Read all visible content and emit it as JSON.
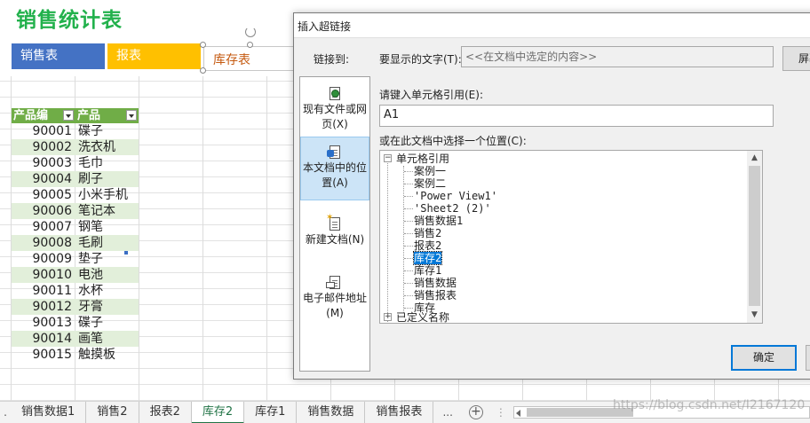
{
  "sheet": {
    "title": "销售统计表",
    "nav_buttons": {
      "sales": "销售表",
      "report": "报表",
      "stock": "库存表"
    },
    "table": {
      "headers": [
        "产品编",
        "产品"
      ],
      "rows": [
        [
          "90001",
          "碟子"
        ],
        [
          "90002",
          "洗衣机"
        ],
        [
          "90003",
          "毛巾"
        ],
        [
          "90004",
          "刷子"
        ],
        [
          "90005",
          "小米手机"
        ],
        [
          "90006",
          "笔记本"
        ],
        [
          "90007",
          "钢笔"
        ],
        [
          "90008",
          "毛刷"
        ],
        [
          "90009",
          "垫子"
        ],
        [
          "90010",
          "电池"
        ],
        [
          "90011",
          "水杯"
        ],
        [
          "90012",
          "牙膏"
        ],
        [
          "90013",
          "碟子"
        ],
        [
          "90014",
          "画笔"
        ],
        [
          "90015",
          "触摸板"
        ]
      ]
    }
  },
  "tabbar": {
    "left_ellipsis": ".",
    "tabs": [
      "销售数据1",
      "销售2",
      "报表2",
      "库存2",
      "库存1",
      "销售数据",
      "销售报表"
    ],
    "active_tab": "库存2",
    "more": "...",
    "add": "+",
    "sep": "⋮"
  },
  "watermark": "https://blog.csdn.net/I2167120",
  "dialog": {
    "title": "插入超链接",
    "link_to_label": "链接到:",
    "link_options": [
      {
        "label": "现有文件或网页(X)",
        "icon": "web-page-icon"
      },
      {
        "label": "本文档中的位置(A)",
        "icon": "document-place-icon"
      },
      {
        "label": "新建文档(N)",
        "icon": "new-document-icon"
      },
      {
        "label": "电子邮件地址(M)",
        "icon": "email-icon"
      }
    ],
    "display_text_label": "要显示的文字(T):",
    "display_text_value": "<<在文档中选定的内容>>",
    "screen_tip_button": "屏幕",
    "cell_ref_label": "请键入单元格引用(E):",
    "cell_ref_value": "A1",
    "place_label": "或在此文档中选择一个位置(C):",
    "tree": {
      "root1": "单元格引用",
      "children": [
        "案例一",
        "案例二",
        "'Power View1'",
        "'Sheet2 (2)'",
        "销售数据1",
        "销售2",
        "报表2",
        "库存2",
        "库存1",
        "销售数据",
        "销售报表",
        "库存"
      ],
      "selected": "库存2",
      "root2": "已定义名称"
    },
    "ok_button": "确定"
  }
}
